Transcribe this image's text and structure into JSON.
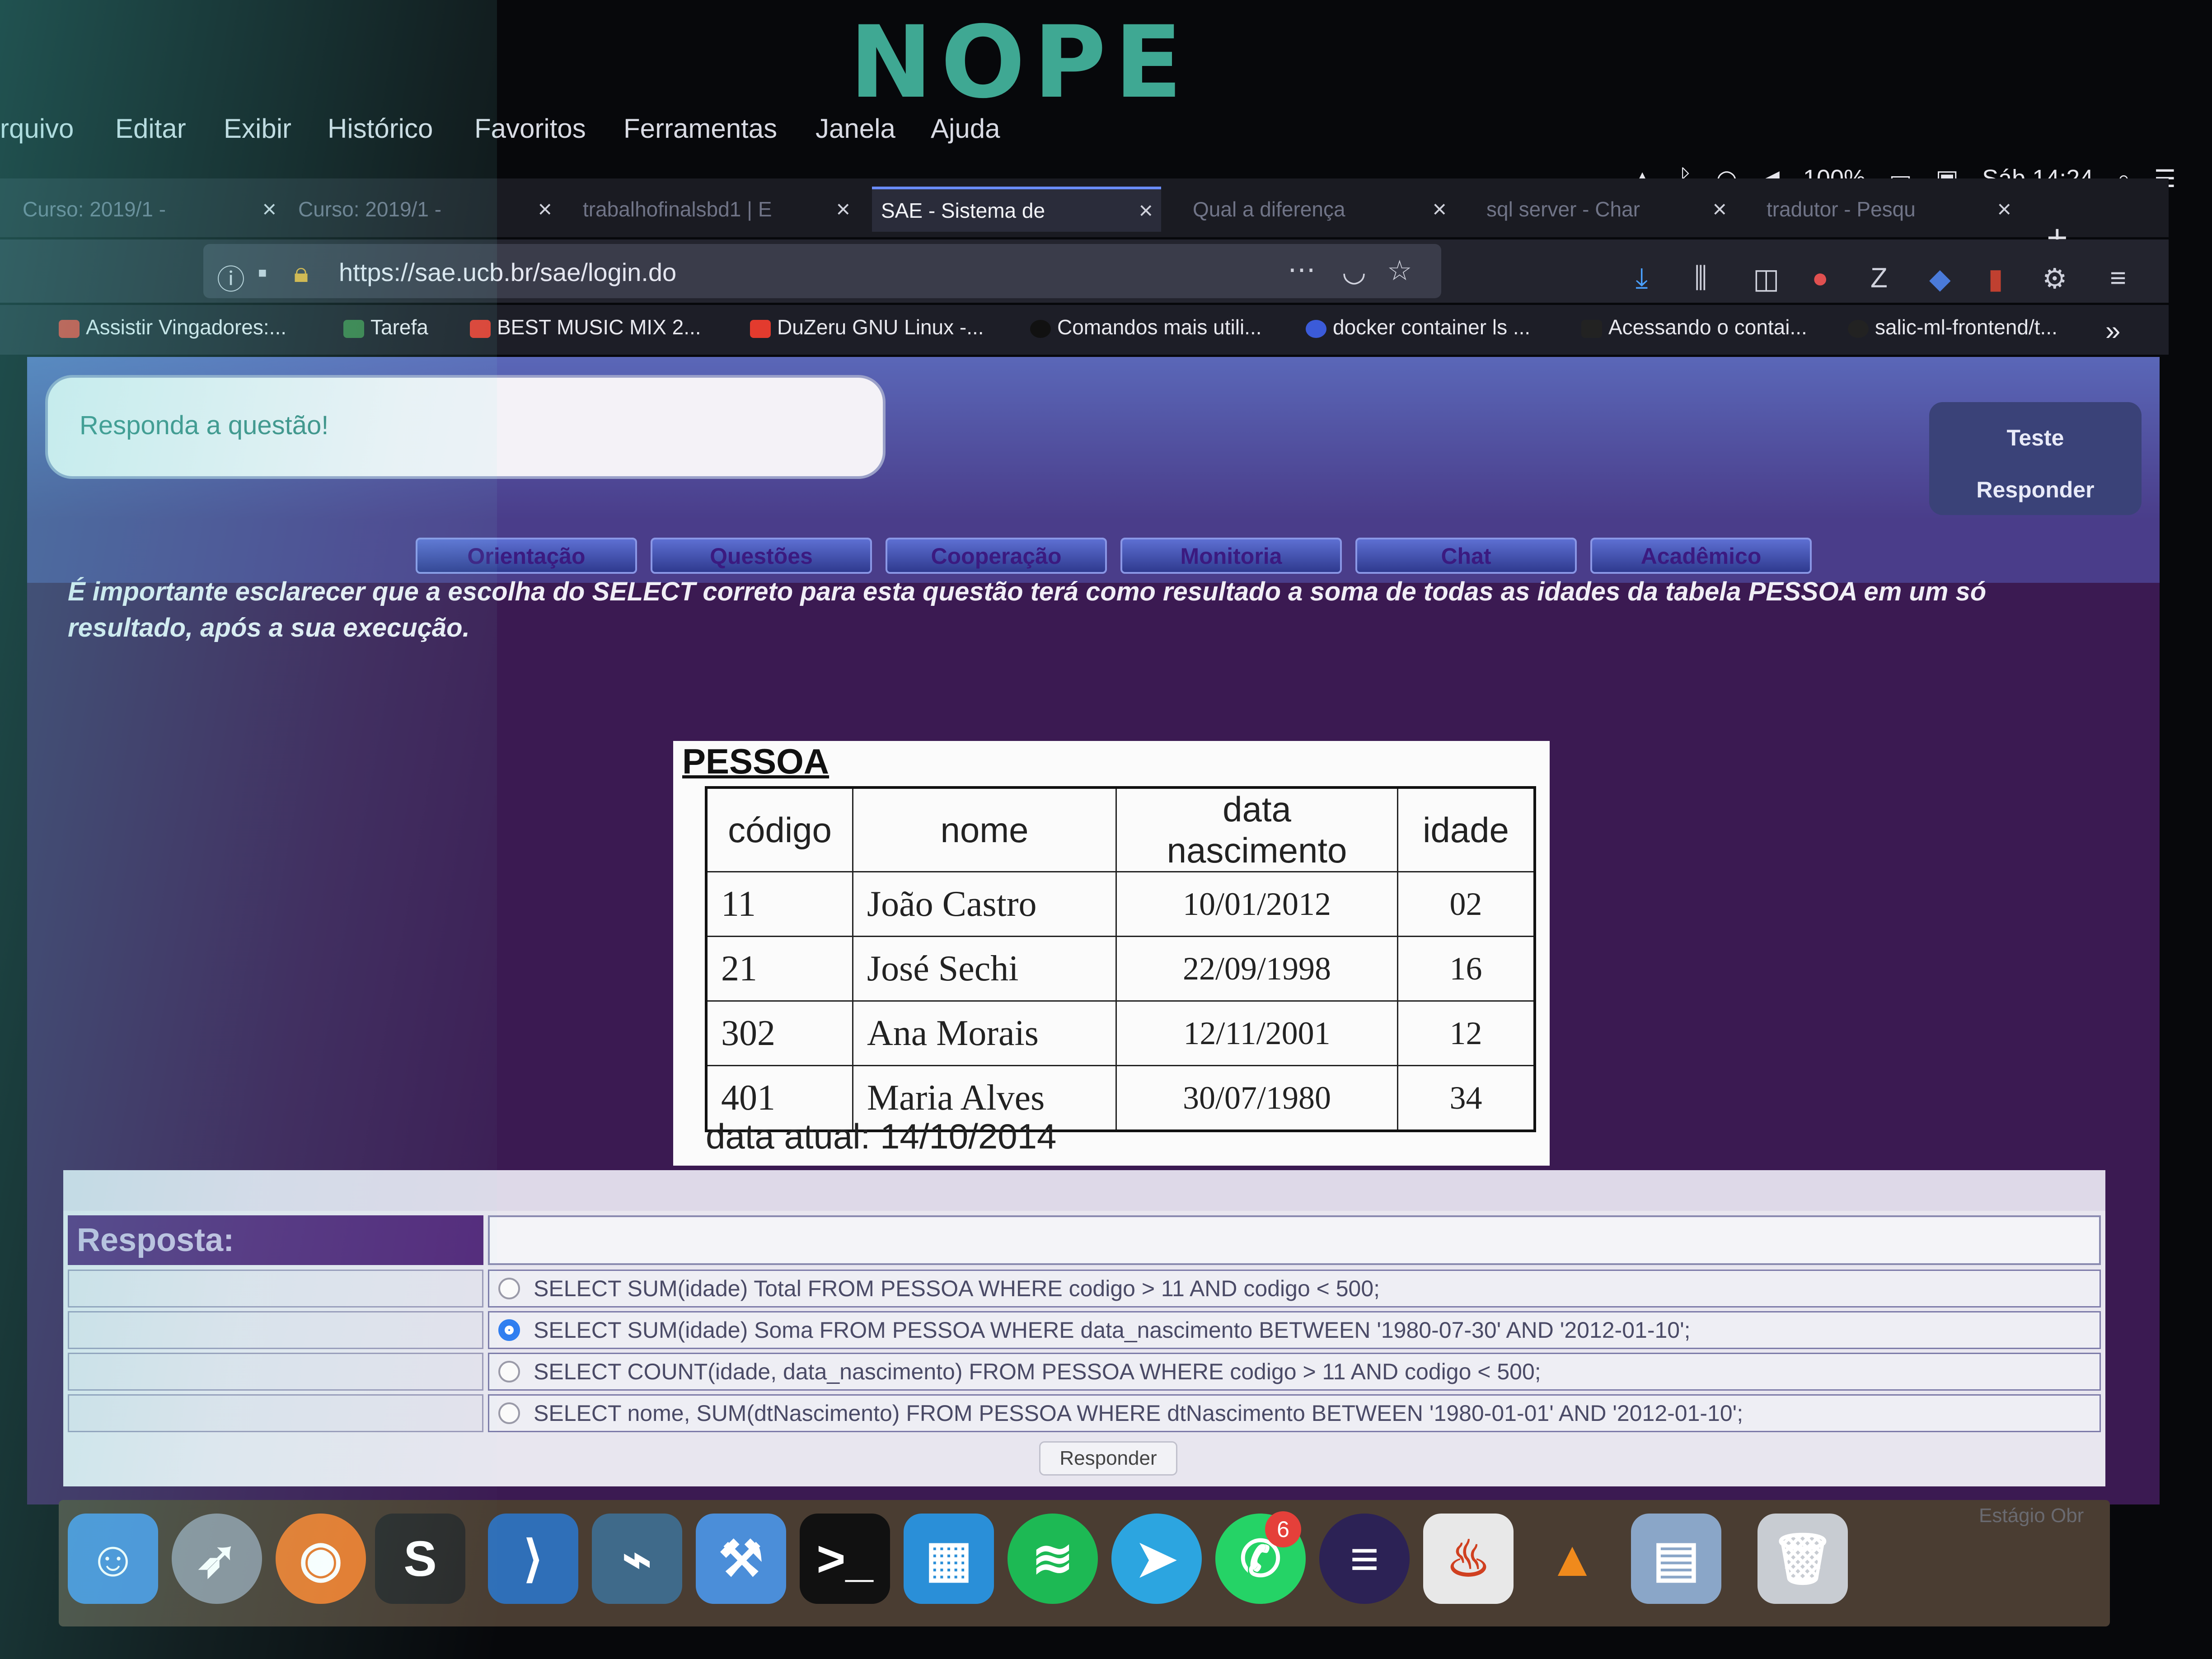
{
  "overlay_text": "NOPE",
  "menubar": {
    "items": [
      "rquivo",
      "Editar",
      "Exibir",
      "Histórico",
      "Favoritos",
      "Ferramentas",
      "Janela",
      "Ajuda"
    ],
    "battery": "100%",
    "clock": "Sáb 14:24"
  },
  "tabs": [
    {
      "label": "Curso: 2019/1 -"
    },
    {
      "label": "Curso: 2019/1 -"
    },
    {
      "label": "trabalhofinalsbd1 | E"
    },
    {
      "label": "SAE - Sistema de"
    },
    {
      "label": "Qual a diferença"
    },
    {
      "label": "sql server - Char"
    },
    {
      "label": "tradutor - Pesqu"
    }
  ],
  "address_bar": {
    "url": "https://sae.ucb.br/sae/login.do"
  },
  "bookmarks": [
    {
      "label": "Assistir Vingadores:...",
      "color": "#e33b2e"
    },
    {
      "label": "Tarefa",
      "color": "#3a7d44"
    },
    {
      "label": "BEST MUSIC MIX 2...",
      "color": "#e33b2e"
    },
    {
      "label": "DuZeru GNU Linux -...",
      "color": "#e33b2e"
    },
    {
      "label": "Comandos mais utili...",
      "color": "#111111"
    },
    {
      "label": "docker container ls ...",
      "color": "#3b5bd9"
    },
    {
      "label": "Acessando o contai...",
      "color": "#222222"
    },
    {
      "label": "salic-ml-frontend/t...",
      "color": "#222222"
    }
  ],
  "header": {
    "prompt": "Responda a questão!",
    "side_buttons": [
      "Teste",
      "Responder"
    ]
  },
  "nav_tabs": [
    "Orientação",
    "Questões",
    "Cooperação",
    "Monitoria",
    "Chat",
    "Acadêmico"
  ],
  "question": {
    "text": "É importante esclarecer que a escolha do SELECT correto para esta questão terá como resultado a soma de todas as idades da tabela PESSOA em um só resultado, após a sua execução."
  },
  "pessoa": {
    "title": "PESSOA",
    "columns": [
      "código",
      "nome",
      "data nascimento",
      "idade"
    ],
    "rows": [
      [
        "11",
        "João Castro",
        "10/01/2012",
        "02"
      ],
      [
        "21",
        "José Sechi",
        "22/09/1998",
        "16"
      ],
      [
        "302",
        "Ana Morais",
        "12/11/2001",
        "12"
      ],
      [
        "401",
        "Maria Alves",
        "30/07/1980",
        "34"
      ]
    ],
    "footer": "data atual: 14/10/2014"
  },
  "answer": {
    "label": "Resposta:",
    "options": [
      {
        "text": "SELECT SUM(idade) Total FROM PESSOA WHERE codigo > 11 AND codigo < 500;",
        "selected": false
      },
      {
        "text": "SELECT SUM(idade) Soma FROM PESSOA WHERE data_nascimento BETWEEN '1980-07-30' AND '2012-01-10';",
        "selected": true
      },
      {
        "text": "SELECT COUNT(idade, data_nascimento) FROM PESSOA WHERE codigo > 11 AND codigo < 500;",
        "selected": false
      },
      {
        "text": "SELECT nome, SUM(dtNascimento) FROM PESSOA WHERE dtNascimento BETWEEN '1980-01-01' AND '2012-01-10';",
        "selected": false
      }
    ],
    "submit_label": "Responder"
  },
  "dock": {
    "apps": [
      "finder",
      "launchpad",
      "firefox",
      "sublime",
      "vscode",
      "mysql-workbench",
      "xcode",
      "terminal",
      "docker",
      "spotify",
      "telegram",
      "whatsapp",
      "eclipse",
      "java",
      "vlc",
      "preview",
      "trash"
    ],
    "whatsapp_badge": "6",
    "corner_text": "Estágio Obr"
  }
}
